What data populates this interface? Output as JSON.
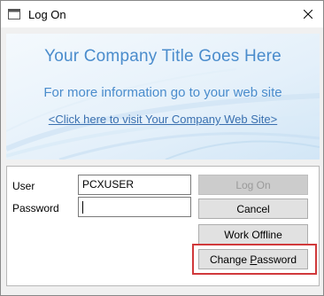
{
  "window": {
    "title": "Log On"
  },
  "banner": {
    "title": "Your Company Title Goes Here",
    "subtitle": "For more information go to your web site",
    "link": "<Click here to visit Your Company Web Site>"
  },
  "form": {
    "user_label": "User",
    "user_value": "PCXUSER",
    "password_label": "Password",
    "password_value": ""
  },
  "buttons": {
    "logon": "Log On",
    "cancel": "Cancel",
    "work_offline": "Work Offline",
    "change_password_pre": "Change ",
    "change_password_ul": "P",
    "change_password_post": "assword"
  },
  "colors": {
    "banner_text": "#4a8ccc",
    "highlight": "#d0393b"
  }
}
